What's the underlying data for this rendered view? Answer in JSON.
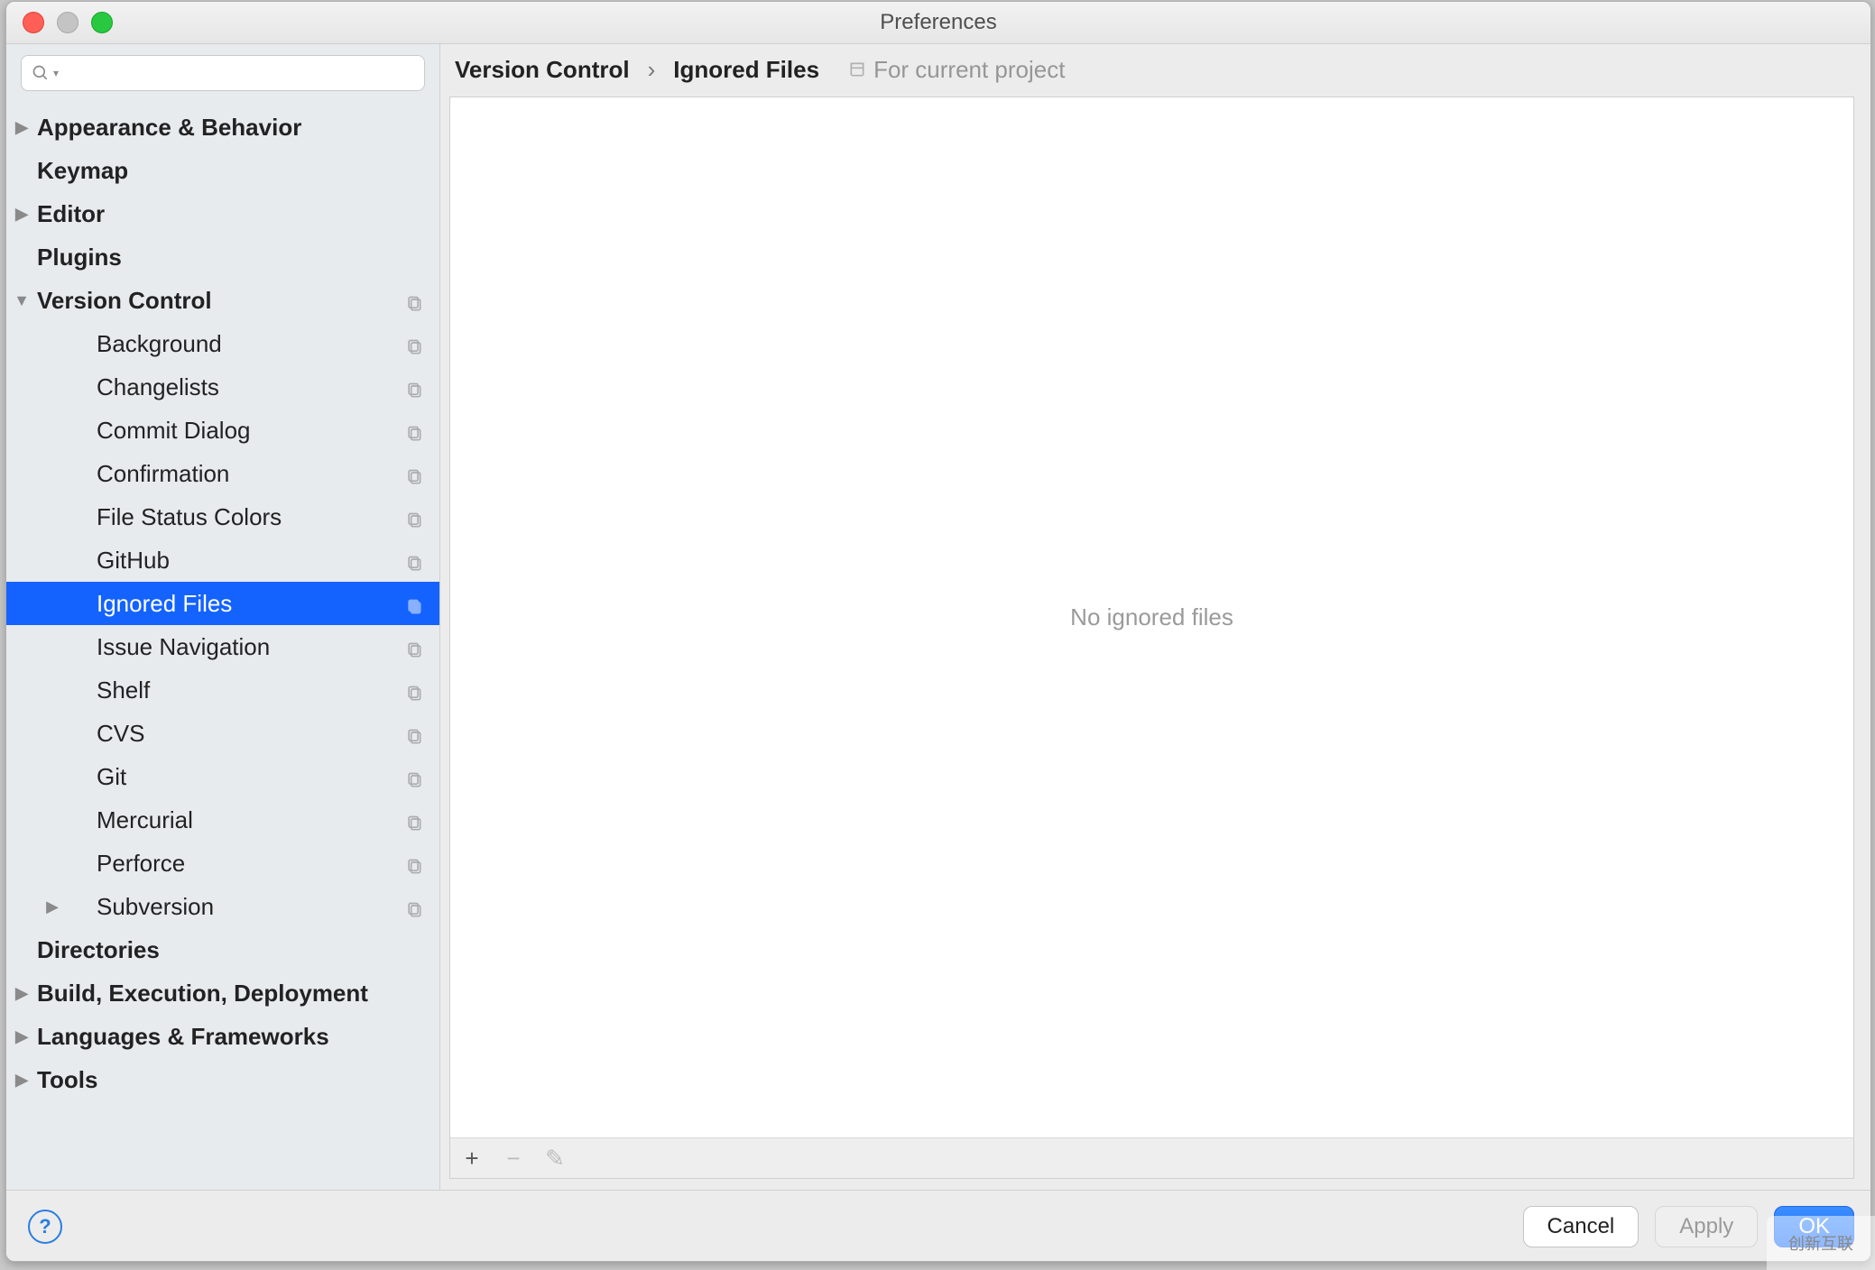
{
  "window": {
    "title": "Preferences"
  },
  "search": {
    "placeholder": ""
  },
  "sidebar": {
    "items": [
      {
        "label": "Appearance & Behavior",
        "top": true,
        "arrow": "right",
        "indent": 0,
        "badge": false
      },
      {
        "label": "Keymap",
        "top": true,
        "arrow": "",
        "indent": 0,
        "badge": false
      },
      {
        "label": "Editor",
        "top": true,
        "arrow": "right",
        "indent": 0,
        "badge": false
      },
      {
        "label": "Plugins",
        "top": true,
        "arrow": "",
        "indent": 0,
        "badge": false
      },
      {
        "label": "Version Control",
        "top": true,
        "arrow": "down",
        "indent": 0,
        "badge": true
      },
      {
        "label": "Background",
        "top": false,
        "arrow": "",
        "indent": 1,
        "badge": true
      },
      {
        "label": "Changelists",
        "top": false,
        "arrow": "",
        "indent": 1,
        "badge": true
      },
      {
        "label": "Commit Dialog",
        "top": false,
        "arrow": "",
        "indent": 1,
        "badge": true
      },
      {
        "label": "Confirmation",
        "top": false,
        "arrow": "",
        "indent": 1,
        "badge": true
      },
      {
        "label": "File Status Colors",
        "top": false,
        "arrow": "",
        "indent": 1,
        "badge": true
      },
      {
        "label": "GitHub",
        "top": false,
        "arrow": "",
        "indent": 1,
        "badge": true
      },
      {
        "label": "Ignored Files",
        "top": false,
        "arrow": "",
        "indent": 1,
        "badge": true,
        "selected": true
      },
      {
        "label": "Issue Navigation",
        "top": false,
        "arrow": "",
        "indent": 1,
        "badge": true
      },
      {
        "label": "Shelf",
        "top": false,
        "arrow": "",
        "indent": 1,
        "badge": true
      },
      {
        "label": "CVS",
        "top": false,
        "arrow": "",
        "indent": 1,
        "badge": true
      },
      {
        "label": "Git",
        "top": false,
        "arrow": "",
        "indent": 1,
        "badge": true
      },
      {
        "label": "Mercurial",
        "top": false,
        "arrow": "",
        "indent": 1,
        "badge": true
      },
      {
        "label": "Perforce",
        "top": false,
        "arrow": "",
        "indent": 1,
        "badge": true
      },
      {
        "label": "Subversion",
        "top": false,
        "arrow": "right",
        "indent": 1,
        "badge": true
      },
      {
        "label": "Directories",
        "top": true,
        "arrow": "",
        "indent": 0,
        "badge": false
      },
      {
        "label": "Build, Execution, Deployment",
        "top": true,
        "arrow": "right",
        "indent": 0,
        "badge": false
      },
      {
        "label": "Languages & Frameworks",
        "top": true,
        "arrow": "right",
        "indent": 0,
        "badge": false
      },
      {
        "label": "Tools",
        "top": true,
        "arrow": "right",
        "indent": 0,
        "badge": false
      }
    ]
  },
  "breadcrumb": {
    "part1": "Version Control",
    "sep": "›",
    "part2": "Ignored Files",
    "scope": "For current project"
  },
  "panel": {
    "empty_text": "No ignored files",
    "toolbar": {
      "add": "+",
      "remove": "−",
      "edit": "✎"
    }
  },
  "footer": {
    "help": "?",
    "cancel": "Cancel",
    "apply": "Apply",
    "ok": "OK"
  },
  "watermark": "创新互联"
}
